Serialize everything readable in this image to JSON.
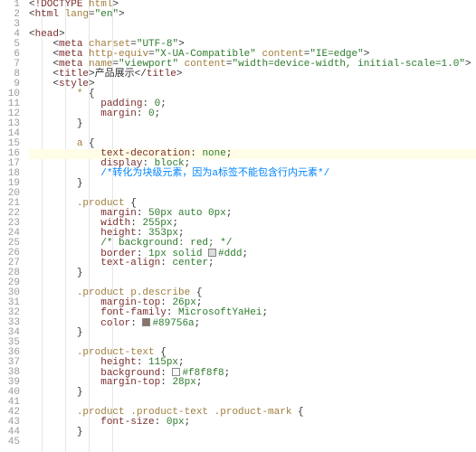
{
  "editor": {
    "highlighted_line": 16,
    "lines": [
      {
        "n": 1,
        "indent": 0,
        "segs": [
          {
            "c": "p",
            "t": "<"
          },
          {
            "c": "tag",
            "t": "!DOCTYPE"
          },
          {
            "c": "p",
            "t": " "
          },
          {
            "c": "attr",
            "t": "html"
          },
          {
            "c": "p",
            "t": ">"
          }
        ]
      },
      {
        "n": 2,
        "indent": 0,
        "segs": [
          {
            "c": "p",
            "t": "<"
          },
          {
            "c": "tag",
            "t": "html"
          },
          {
            "c": "p",
            "t": " "
          },
          {
            "c": "attr",
            "t": "lang"
          },
          {
            "c": "p",
            "t": "="
          },
          {
            "c": "str",
            "t": "\"en\""
          },
          {
            "c": "p",
            "t": ">"
          }
        ]
      },
      {
        "n": 3,
        "indent": 0,
        "segs": []
      },
      {
        "n": 4,
        "indent": 0,
        "segs": [
          {
            "c": "p",
            "t": "<"
          },
          {
            "c": "tag",
            "t": "head"
          },
          {
            "c": "p",
            "t": ">"
          }
        ]
      },
      {
        "n": 5,
        "indent": 1,
        "segs": [
          {
            "c": "p",
            "t": "<"
          },
          {
            "c": "tag",
            "t": "meta"
          },
          {
            "c": "p",
            "t": " "
          },
          {
            "c": "attr",
            "t": "charset"
          },
          {
            "c": "p",
            "t": "="
          },
          {
            "c": "str",
            "t": "\"UTF-8\""
          },
          {
            "c": "p",
            "t": ">"
          }
        ]
      },
      {
        "n": 6,
        "indent": 1,
        "segs": [
          {
            "c": "p",
            "t": "<"
          },
          {
            "c": "tag",
            "t": "meta"
          },
          {
            "c": "p",
            "t": " "
          },
          {
            "c": "attr",
            "t": "http-equiv"
          },
          {
            "c": "p",
            "t": "="
          },
          {
            "c": "str",
            "t": "\"X-UA-Compatible\""
          },
          {
            "c": "p",
            "t": " "
          },
          {
            "c": "attr",
            "t": "content"
          },
          {
            "c": "p",
            "t": "="
          },
          {
            "c": "str",
            "t": "\"IE=edge\""
          },
          {
            "c": "p",
            "t": ">"
          }
        ]
      },
      {
        "n": 7,
        "indent": 1,
        "segs": [
          {
            "c": "p",
            "t": "<"
          },
          {
            "c": "tag",
            "t": "meta"
          },
          {
            "c": "p",
            "t": " "
          },
          {
            "c": "attr",
            "t": "name"
          },
          {
            "c": "p",
            "t": "="
          },
          {
            "c": "str",
            "t": "\"viewport\""
          },
          {
            "c": "p",
            "t": " "
          },
          {
            "c": "attr",
            "t": "content"
          },
          {
            "c": "p",
            "t": "="
          },
          {
            "c": "str",
            "t": "\"width=device-width, initial-scale=1.0\""
          },
          {
            "c": "p",
            "t": ">"
          }
        ]
      },
      {
        "n": 8,
        "indent": 1,
        "segs": [
          {
            "c": "p",
            "t": "<"
          },
          {
            "c": "tag",
            "t": "title"
          },
          {
            "c": "p",
            "t": ">产品展示</"
          },
          {
            "c": "tag",
            "t": "title"
          },
          {
            "c": "p",
            "t": ">"
          }
        ]
      },
      {
        "n": 9,
        "indent": 1,
        "segs": [
          {
            "c": "p",
            "t": "<"
          },
          {
            "c": "tag",
            "t": "style"
          },
          {
            "c": "p",
            "t": ">"
          }
        ]
      },
      {
        "n": 10,
        "indent": 2,
        "segs": [
          {
            "c": "sel",
            "t": "*"
          },
          {
            "c": "p",
            "t": " {"
          }
        ]
      },
      {
        "n": 11,
        "indent": 3,
        "segs": [
          {
            "c": "prop",
            "t": "padding"
          },
          {
            "c": "p",
            "t": ": "
          },
          {
            "c": "val",
            "t": "0"
          },
          {
            "c": "p",
            "t": ";"
          }
        ]
      },
      {
        "n": 12,
        "indent": 3,
        "segs": [
          {
            "c": "prop",
            "t": "margin"
          },
          {
            "c": "p",
            "t": ": "
          },
          {
            "c": "val",
            "t": "0"
          },
          {
            "c": "p",
            "t": ";"
          }
        ]
      },
      {
        "n": 13,
        "indent": 2,
        "segs": [
          {
            "c": "p",
            "t": "}"
          }
        ]
      },
      {
        "n": 14,
        "indent": 0,
        "segs": []
      },
      {
        "n": 15,
        "indent": 2,
        "segs": [
          {
            "c": "sel",
            "t": "a"
          },
          {
            "c": "p",
            "t": " {"
          }
        ]
      },
      {
        "n": 16,
        "indent": 3,
        "segs": [
          {
            "c": "prop",
            "t": "text-decoration"
          },
          {
            "c": "p",
            "t": ": "
          },
          {
            "c": "val",
            "t": "none"
          },
          {
            "c": "p",
            "t": ";"
          }
        ]
      },
      {
        "n": 17,
        "indent": 3,
        "segs": [
          {
            "c": "prop",
            "t": "display"
          },
          {
            "c": "p",
            "t": ": "
          },
          {
            "c": "val",
            "t": "block"
          },
          {
            "c": "p",
            "t": ";"
          }
        ]
      },
      {
        "n": 18,
        "indent": 3,
        "segs": [
          {
            "c": "cmt",
            "t": "/*转化为块级元素，因为a标签不能包含行内元素*/"
          }
        ]
      },
      {
        "n": 19,
        "indent": 2,
        "segs": [
          {
            "c": "p",
            "t": "}"
          }
        ]
      },
      {
        "n": 20,
        "indent": 0,
        "segs": []
      },
      {
        "n": 21,
        "indent": 2,
        "segs": [
          {
            "c": "sel",
            "t": ".product"
          },
          {
            "c": "p",
            "t": " {"
          }
        ]
      },
      {
        "n": 22,
        "indent": 3,
        "segs": [
          {
            "c": "prop",
            "t": "margin"
          },
          {
            "c": "p",
            "t": ": "
          },
          {
            "c": "val",
            "t": "50px auto 0px"
          },
          {
            "c": "p",
            "t": ";"
          }
        ]
      },
      {
        "n": 23,
        "indent": 3,
        "segs": [
          {
            "c": "prop",
            "t": "width"
          },
          {
            "c": "p",
            "t": ": "
          },
          {
            "c": "val",
            "t": "255px"
          },
          {
            "c": "p",
            "t": ";"
          }
        ]
      },
      {
        "n": 24,
        "indent": 3,
        "segs": [
          {
            "c": "prop",
            "t": "height"
          },
          {
            "c": "p",
            "t": ": "
          },
          {
            "c": "val",
            "t": "353px"
          },
          {
            "c": "p",
            "t": ";"
          }
        ]
      },
      {
        "n": 25,
        "indent": 3,
        "segs": [
          {
            "c": "cmt2",
            "t": "/* background: red; */"
          }
        ]
      },
      {
        "n": 26,
        "indent": 3,
        "segs": [
          {
            "c": "prop",
            "t": "border"
          },
          {
            "c": "p",
            "t": ": "
          },
          {
            "c": "val",
            "t": "1px solid "
          },
          {
            "c": "sw",
            "t": "",
            "swatch": "#dddddd"
          },
          {
            "c": "val",
            "t": "#ddd"
          },
          {
            "c": "p",
            "t": ";"
          }
        ]
      },
      {
        "n": 27,
        "indent": 3,
        "segs": [
          {
            "c": "prop",
            "t": "text-align"
          },
          {
            "c": "p",
            "t": ": "
          },
          {
            "c": "val",
            "t": "center"
          },
          {
            "c": "p",
            "t": ";"
          }
        ]
      },
      {
        "n": 28,
        "indent": 2,
        "segs": [
          {
            "c": "p",
            "t": "}"
          }
        ]
      },
      {
        "n": 29,
        "indent": 0,
        "segs": []
      },
      {
        "n": 30,
        "indent": 2,
        "segs": [
          {
            "c": "sel",
            "t": ".product p.describe"
          },
          {
            "c": "p",
            "t": " {"
          }
        ]
      },
      {
        "n": 31,
        "indent": 3,
        "segs": [
          {
            "c": "prop",
            "t": "margin-top"
          },
          {
            "c": "p",
            "t": ": "
          },
          {
            "c": "val",
            "t": "26px"
          },
          {
            "c": "p",
            "t": ";"
          }
        ]
      },
      {
        "n": 32,
        "indent": 3,
        "segs": [
          {
            "c": "prop",
            "t": "font-family"
          },
          {
            "c": "p",
            "t": ": "
          },
          {
            "c": "val",
            "t": "MicrosoftYaHei"
          },
          {
            "c": "p",
            "t": ";"
          }
        ]
      },
      {
        "n": 33,
        "indent": 3,
        "segs": [
          {
            "c": "prop",
            "t": "color"
          },
          {
            "c": "p",
            "t": ": "
          },
          {
            "c": "sw",
            "t": "",
            "swatch": "#89756a"
          },
          {
            "c": "val",
            "t": "#89756a"
          },
          {
            "c": "p",
            "t": ";"
          }
        ]
      },
      {
        "n": 34,
        "indent": 2,
        "segs": [
          {
            "c": "p",
            "t": "}"
          }
        ]
      },
      {
        "n": 35,
        "indent": 0,
        "segs": []
      },
      {
        "n": 36,
        "indent": 2,
        "segs": [
          {
            "c": "sel",
            "t": ".product-text"
          },
          {
            "c": "p",
            "t": " {"
          }
        ]
      },
      {
        "n": 37,
        "indent": 3,
        "segs": [
          {
            "c": "prop",
            "t": "height"
          },
          {
            "c": "p",
            "t": ": "
          },
          {
            "c": "val",
            "t": "115px"
          },
          {
            "c": "p",
            "t": ";"
          }
        ]
      },
      {
        "n": 38,
        "indent": 3,
        "segs": [
          {
            "c": "prop",
            "t": "background"
          },
          {
            "c": "p",
            "t": ": "
          },
          {
            "c": "sw",
            "t": "",
            "swatch": "#f8f8f8"
          },
          {
            "c": "val",
            "t": "#f8f8f8"
          },
          {
            "c": "p",
            "t": ";"
          }
        ]
      },
      {
        "n": 39,
        "indent": 3,
        "segs": [
          {
            "c": "prop",
            "t": "margin-top"
          },
          {
            "c": "p",
            "t": ": "
          },
          {
            "c": "val",
            "t": "28px"
          },
          {
            "c": "p",
            "t": ";"
          }
        ]
      },
      {
        "n": 40,
        "indent": 2,
        "segs": [
          {
            "c": "p",
            "t": "}"
          }
        ]
      },
      {
        "n": 41,
        "indent": 0,
        "segs": []
      },
      {
        "n": 42,
        "indent": 2,
        "segs": [
          {
            "c": "sel",
            "t": ".product .product-text .product-mark"
          },
          {
            "c": "p",
            "t": " {"
          }
        ]
      },
      {
        "n": 43,
        "indent": 3,
        "segs": [
          {
            "c": "prop",
            "t": "font-size"
          },
          {
            "c": "p",
            "t": ": "
          },
          {
            "c": "val",
            "t": "0px"
          },
          {
            "c": "p",
            "t": ";"
          }
        ]
      },
      {
        "n": 44,
        "indent": 2,
        "segs": [
          {
            "c": "p",
            "t": "}"
          }
        ]
      },
      {
        "n": 45,
        "indent": 0,
        "segs": []
      }
    ]
  }
}
